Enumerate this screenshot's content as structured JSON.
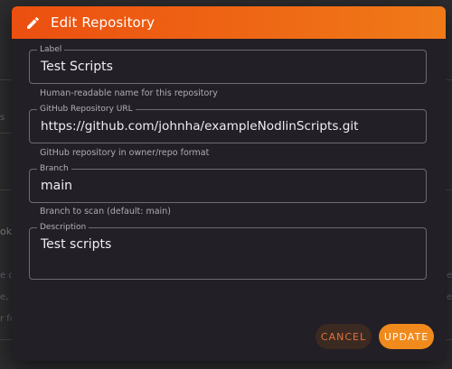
{
  "background": {
    "fragments": [
      "s",
      "ok",
      "e c",
      "e,",
      "r fo",
      "e",
      "e"
    ]
  },
  "dialog": {
    "title": "Edit Repository",
    "title_icon": "pencil-icon",
    "fields": {
      "label": {
        "label": "Label",
        "value": "Test Scripts",
        "helper": "Human-readable name for this repository"
      },
      "url": {
        "label": "GitHub Repository URL",
        "value": "https://github.com/johnha/exampleNodlinScripts.git",
        "helper": "GitHub repository in owner/repo format"
      },
      "branch": {
        "label": "Branch",
        "value": "main",
        "helper": "Branch to scan (default: main)"
      },
      "description": {
        "label": "Description",
        "value": "Test scripts"
      }
    },
    "buttons": {
      "cancel": "CANCEL",
      "update": "UPDATE"
    }
  },
  "colors": {
    "header_start": "#ec4f10",
    "header_end": "#f07a18",
    "dialog_bg": "#221f26",
    "accent": "#f08a1c"
  }
}
